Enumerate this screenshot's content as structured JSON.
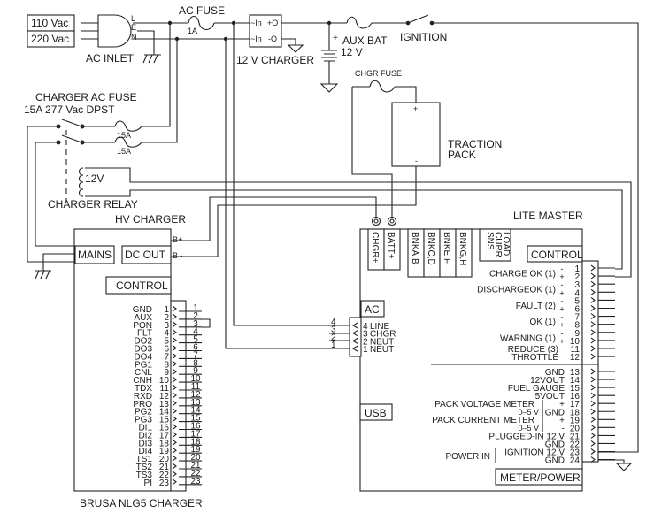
{
  "sources": {
    "v110": "110 Vac",
    "v220": "220 Vac"
  },
  "ac_inlet": {
    "label": "AC INLET",
    "pins": [
      "L",
      "E",
      "N"
    ]
  },
  "ac_fuse": {
    "label": "AC FUSE",
    "rating": "1A"
  },
  "charger_12v": {
    "label": "12 V CHARGER",
    "in1": "~In",
    "out1": "+O",
    "in2": "~In",
    "out2": "-O"
  },
  "aux_bat": {
    "label": "AUX BAT",
    "voltage": "12 V",
    "plus": "+"
  },
  "ignition": {
    "label": "IGNITION"
  },
  "chgr_fuse": {
    "label": "CHGR FUSE"
  },
  "traction_pack": {
    "line1": "TRACTION",
    "line2": "PACK",
    "plus": "+",
    "minus": "-"
  },
  "charger_ac_fuse": {
    "line1": "CHARGER AC FUSE",
    "line2": "15A 277 Vac DPST",
    "rating1": "15A",
    "rating2": "15A"
  },
  "charger_relay": {
    "label": "CHARGER RELAY",
    "coil": "12V"
  },
  "hv_charger": {
    "title": "HV CHARGER",
    "model": "BRUSA NLG5 CHARGER",
    "mains": "MAINS",
    "dc_out": "DC OUT",
    "b_plus": "B+",
    "b_minus": "B -",
    "control": "CONTROL",
    "pins": [
      {
        "name": "GND",
        "num": "1"
      },
      {
        "name": "AUX",
        "num": "2"
      },
      {
        "name": "PON",
        "num": "3"
      },
      {
        "name": "FLT",
        "num": "4"
      },
      {
        "name": "DO2",
        "num": "5"
      },
      {
        "name": "DO3",
        "num": "6"
      },
      {
        "name": "DO4",
        "num": "7"
      },
      {
        "name": "PG1",
        "num": "8"
      },
      {
        "name": "CNL",
        "num": "9"
      },
      {
        "name": "CNH",
        "num": "10"
      },
      {
        "name": "TDX",
        "num": "11"
      },
      {
        "name": "RXD",
        "num": "12"
      },
      {
        "name": "PRO",
        "num": "13"
      },
      {
        "name": "PG2",
        "num": "14"
      },
      {
        "name": "PG3",
        "num": "15"
      },
      {
        "name": "DI1",
        "num": "16"
      },
      {
        "name": "DI2",
        "num": "17"
      },
      {
        "name": "DI3",
        "num": "18"
      },
      {
        "name": "DI4",
        "num": "19"
      },
      {
        "name": "TS1",
        "num": "20"
      },
      {
        "name": "TS2",
        "num": "21"
      },
      {
        "name": "TS3",
        "num": "22"
      },
      {
        "name": "PI",
        "num": "23"
      }
    ]
  },
  "lite_master": {
    "title": "LITE MASTER",
    "terminals": [
      "CHGR+",
      "BATT+"
    ],
    "banks": [
      "BNKA,B",
      "BNKC,D",
      "BNKE,F",
      "BNKG,H"
    ],
    "load_sense": [
      "LOAD",
      "CURR",
      "SNS"
    ],
    "control": "CONTROL",
    "usb": "USB",
    "meter_power": "METER/POWER",
    "ac": {
      "label": "AC",
      "pins": [
        {
          "num": "4",
          "name": "LINE"
        },
        {
          "num": "3",
          "name": "CHGR"
        },
        {
          "num": "2",
          "name": "NEUT"
        },
        {
          "num": "1",
          "name": "NEUT"
        }
      ]
    },
    "control_labels": [
      "CHARGE OK (1)",
      "DISCHARGEOK (1)",
      "FAULT (2)",
      "OK (1)",
      "WARNING (1)",
      "REDUCE (3)",
      "THROTTLE"
    ],
    "control_pins": [
      {
        "sign": "-",
        "num": "1"
      },
      {
        "sign": "+",
        "num": "2"
      },
      {
        "sign": "-",
        "num": "3"
      },
      {
        "sign": "+",
        "num": "4"
      },
      {
        "sign": "-",
        "num": "5"
      },
      {
        "sign": "+",
        "num": "6"
      },
      {
        "sign": "-",
        "num": "7"
      },
      {
        "sign": "+",
        "num": "8"
      },
      {
        "sign": "-",
        "num": "9"
      },
      {
        "sign": "+",
        "num": "10"
      },
      {
        "sign": "",
        "num": "11"
      },
      {
        "sign": "",
        "num": "12"
      }
    ],
    "meter_pins": [
      {
        "label": "GND",
        "num": "13"
      },
      {
        "label": "12VOUT",
        "num": "14"
      },
      {
        "label": "FUEL GAUGE",
        "num": "15"
      },
      {
        "label": "5VOUT",
        "num": "16"
      },
      {
        "label": "+",
        "num": "17"
      },
      {
        "label": "GND",
        "num": "18"
      },
      {
        "label": "+",
        "num": "19"
      },
      {
        "label": "-",
        "num": "20"
      },
      {
        "label": "PLUGGED-IN 12 V",
        "num": "21"
      },
      {
        "label": "GND",
        "num": "22"
      },
      {
        "label": "IGNITION 12 V",
        "num": "23"
      },
      {
        "label": "GND",
        "num": "24"
      }
    ],
    "pack_voltage_meter": "PACK VOLTAGE METER",
    "pack_voltage_range": "0–5 V",
    "pack_current_meter": "PACK CURRENT METER",
    "pack_current_range": "0–5 V",
    "power_in": "POWER IN"
  }
}
